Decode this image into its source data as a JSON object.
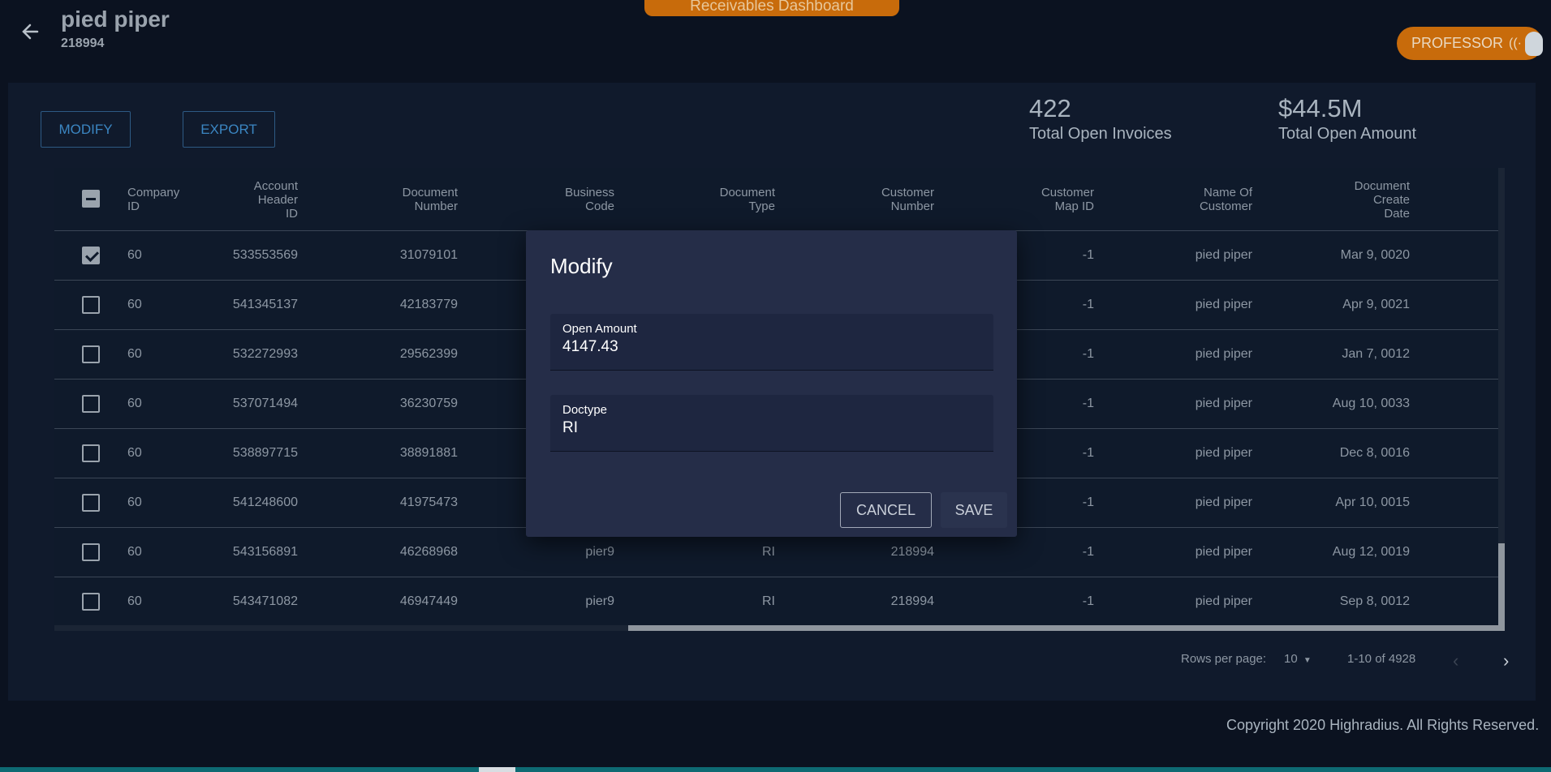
{
  "header": {
    "title": "pied piper",
    "subtitle": "218994",
    "dashboard_tab": "Receivables Dashboard",
    "profile_label": "PROFESSOR",
    "profile_wave": "((·"
  },
  "toolbar": {
    "modify_label": "MODIFY",
    "export_label": "EXPORT"
  },
  "stats": [
    {
      "value": "422",
      "label": "Total Open Invoices"
    },
    {
      "value": "$44.5M",
      "label": "Total Open Amount"
    }
  ],
  "table": {
    "columns": [
      [
        "Company",
        "ID"
      ],
      [
        "Account",
        "Header",
        "ID"
      ],
      [
        "Document",
        "Number"
      ],
      [
        "Business",
        "Code"
      ],
      [
        "Document",
        "Type"
      ],
      [
        "Customer",
        "Number"
      ],
      [
        "Customer",
        "Map ID"
      ],
      [
        "Name Of",
        "Customer"
      ],
      [
        "Document",
        "Create",
        "Date"
      ]
    ],
    "rows": [
      {
        "checked": true,
        "cells": [
          "60",
          "533553569",
          "31079101",
          "",
          "",
          "",
          "-1",
          "pied piper",
          "Mar 9, 0020"
        ]
      },
      {
        "checked": false,
        "cells": [
          "60",
          "541345137",
          "42183779",
          "",
          "",
          "",
          "-1",
          "pied piper",
          "Apr 9, 0021"
        ]
      },
      {
        "checked": false,
        "cells": [
          "60",
          "532272993",
          "29562399",
          "",
          "",
          "",
          "-1",
          "pied piper",
          "Jan 7, 0012"
        ]
      },
      {
        "checked": false,
        "cells": [
          "60",
          "537071494",
          "36230759",
          "",
          "",
          "",
          "-1",
          "pied piper",
          "Aug 10, 0033"
        ]
      },
      {
        "checked": false,
        "cells": [
          "60",
          "538897715",
          "38891881",
          "",
          "",
          "",
          "-1",
          "pied piper",
          "Dec 8, 0016"
        ]
      },
      {
        "checked": false,
        "cells": [
          "60",
          "541248600",
          "41975473",
          "",
          "",
          "",
          "-1",
          "pied piper",
          "Apr 10, 0015"
        ]
      },
      {
        "checked": false,
        "cells": [
          "60",
          "543156891",
          "46268968",
          "pier9",
          "RI",
          "218994",
          "-1",
          "pied piper",
          "Aug 12, 0019"
        ]
      },
      {
        "checked": false,
        "cells": [
          "60",
          "543471082",
          "46947449",
          "pier9",
          "RI",
          "218994",
          "-1",
          "pied piper",
          "Sep 8, 0012"
        ]
      }
    ]
  },
  "pagination": {
    "rows_per_page_label": "Rows per page:",
    "rows_per_page_value": "10",
    "range_text": "1-10 of 4928"
  },
  "footer": {
    "copyright": "Copyright 2020 Highradius. All Rights Reserved."
  },
  "modal": {
    "title": "Modify",
    "fields": [
      {
        "label": "Open Amount",
        "value": "4147.43"
      },
      {
        "label": "Doctype",
        "value": "RI"
      }
    ],
    "cancel_label": "CANCEL",
    "save_label": "SAVE"
  }
}
